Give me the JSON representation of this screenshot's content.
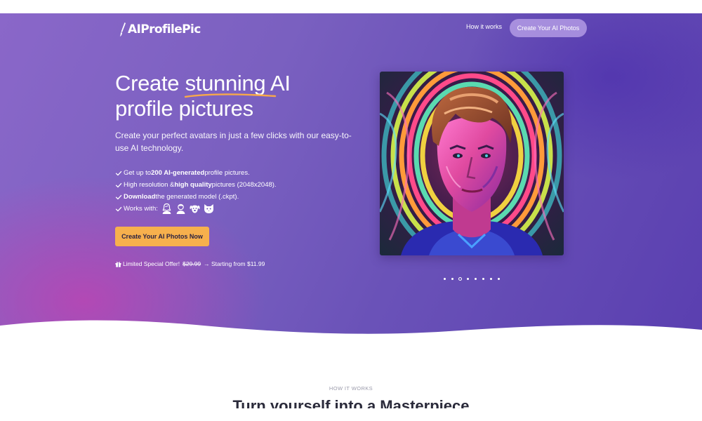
{
  "brand": {
    "logo_text": "AIProfilePic"
  },
  "nav": {
    "link_label": "How it works",
    "cta_label": "Create Your AI Photos"
  },
  "hero": {
    "headline_start": "Create ",
    "headline_highlight": "stunning",
    "headline_end": " AI profile pictures",
    "subtitle": "Create your perfect avatars in just a few clicks with our easy-to-use AI technology.",
    "features": {
      "f1_pre": "Get up to ",
      "f1_bold": "200 AI-generated",
      "f1_post": " profile pictures.",
      "f2_pre": "High resolution & ",
      "f2_bold": "high quality",
      "f2_post": " pictures (2048x2048).",
      "f3_bold": "Download",
      "f3_post": " the generated model (.ckpt).",
      "f4_pre": "Works with:"
    },
    "works_with_icons": [
      "woman-icon",
      "man-icon",
      "dog-icon",
      "cat-icon"
    ],
    "cta_label": "Create Your AI Photos Now",
    "offer": {
      "label": "Limited Special Offer!",
      "old_price": "$29.99",
      "arrow_text": "→ Starting from $11.99"
    }
  },
  "carousel": {
    "slide_count": 8,
    "active_index": 2
  },
  "how_it_works": {
    "label": "HOW IT WORKS",
    "title": "Turn yourself into a Masterpiece"
  },
  "colors": {
    "accent": "#f7b04d",
    "underline": "#f7a84a",
    "hero_start": "#8a67c9",
    "hero_end": "#5a3fb0",
    "highlight_pink": "#c440b0"
  }
}
